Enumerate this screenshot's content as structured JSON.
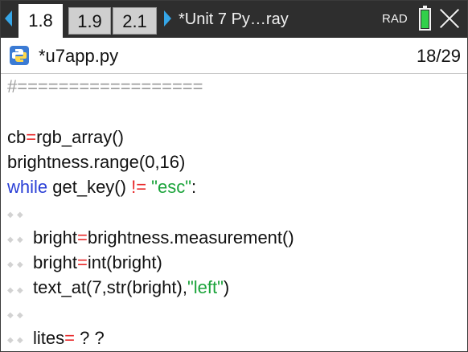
{
  "tabs": [
    {
      "label": "1.8",
      "active": true
    },
    {
      "label": "1.9",
      "active": false
    },
    {
      "label": "2.1",
      "active": false
    }
  ],
  "document_title": "*Unit 7 Py…ray",
  "angle_mode": "RAD",
  "battery_color": "#32d04a",
  "editor": {
    "file_name": "*u7app.py",
    "line_counter": "18/29"
  },
  "code": {
    "comment": "#==================",
    "l3_a": "cb",
    "l3_eq": "=",
    "l3_b": "rgb_array()",
    "l4": "brightness.range(0,16)",
    "l5_kw": "while",
    "l5_a": " get_key() ",
    "l5_op": "!=",
    "l5_sp": " ",
    "l5_str": "\"esc\"",
    "l5_end": ":",
    "l7_a": "bright",
    "l7_eq": "=",
    "l7_b": "brightness.measurement()",
    "l8_a": "bright",
    "l8_eq": "=",
    "l8_b": "int(bright)",
    "l9_a": "text_at(7,str(bright),",
    "l9_str": "\"left\"",
    "l9_end": ")",
    "l11_a": "lites",
    "l11_eq": "=",
    "l11_b": " ? ?"
  },
  "colors": {
    "accent": "#35a6e8",
    "keyword": "#2a3fd6",
    "operator": "#e8292a",
    "string": "#1aa33a"
  }
}
